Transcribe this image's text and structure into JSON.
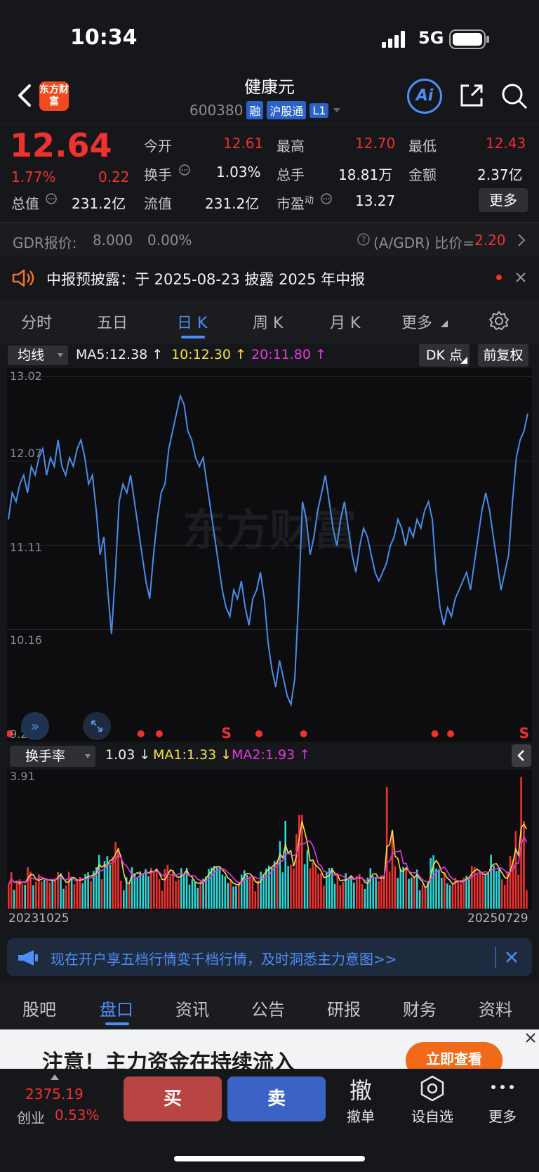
{
  "status_bar": {
    "time": "10:34",
    "network": "5G"
  },
  "header": {
    "stock_name": "健康元",
    "stock_code": "600380",
    "tags": [
      "融",
      "沪股通",
      "L1"
    ],
    "logo_text": "东方财富",
    "ai_label": "Ai"
  },
  "quote": {
    "price": "12.64",
    "change_pct": "1.77%",
    "change_amt": "0.22",
    "fields": [
      {
        "label": "今开",
        "value": "12.61",
        "color": "#f0312f"
      },
      {
        "label": "最高",
        "value": "12.70",
        "color": "#f0312f"
      },
      {
        "label": "最低",
        "value": "12.43",
        "color": "#f0312f"
      },
      {
        "label": "换手",
        "value": "1.03%",
        "color": "#f2f2f2"
      },
      {
        "label": "总手",
        "value": "18.81万",
        "color": "#f2f2f2"
      },
      {
        "label": "金额",
        "value": "2.37亿",
        "color": "#f2f2f2"
      },
      {
        "label": "总值",
        "value": "231.2亿",
        "color": "#f2f2f2"
      },
      {
        "label": "流值",
        "value": "231.2亿",
        "color": "#f2f2f2"
      },
      {
        "label": "市盈",
        "label_sup": "动",
        "value": "13.27",
        "color": "#f2f2f2"
      }
    ],
    "more_label": "更多"
  },
  "gdr": {
    "label": "GDR报价:",
    "price": "8.000",
    "pct": "0.00%",
    "ratio_label": "(A/GDR) 比价=",
    "ratio_value": "2.20"
  },
  "notice": {
    "text": "中报预披露：于 2025-08-23 披露 2025 年中报"
  },
  "chart_tabs": [
    "分时",
    "五日",
    "日 K",
    "周 K",
    "月 K",
    "更多"
  ],
  "indicator_bar": {
    "type_label": "均线",
    "ma5": "MA5:12.38",
    "ma10": "10:12.30",
    "ma20": "20:11.80",
    "dk_label": "DK 点",
    "adjust_label": "前复权"
  },
  "watermark": "东方财富",
  "chart_data": [
    {
      "type": "line",
      "name": "price",
      "ylim": [
        9.2,
        13.02
      ],
      "y_ticks": [
        "13.02",
        "12.07",
        "11.11",
        "10.16",
        "9.20"
      ],
      "x_range": [
        "20231025",
        "20250729"
      ],
      "values": [
        11.4,
        11.7,
        11.6,
        11.8,
        11.9,
        11.7,
        12.0,
        11.9,
        12.1,
        12.2,
        11.9,
        12.1,
        12.0,
        12.3,
        12.0,
        11.9,
        12.1,
        12.0,
        12.2,
        12.3,
        12.1,
        11.8,
        11.9,
        11.5,
        11.0,
        11.2,
        10.6,
        10.1,
        10.8,
        11.6,
        11.8,
        11.7,
        11.9,
        11.6,
        11.3,
        11.0,
        10.7,
        10.5,
        11.0,
        11.4,
        11.7,
        11.8,
        12.2,
        12.4,
        12.6,
        12.8,
        12.7,
        12.4,
        12.3,
        12.1,
        12.0,
        12.1,
        11.8,
        11.5,
        11.2,
        10.9,
        10.6,
        10.4,
        10.3,
        10.6,
        10.5,
        10.7,
        10.4,
        10.2,
        10.5,
        10.6,
        10.8,
        10.5,
        10.0,
        9.7,
        9.5,
        9.8,
        9.6,
        9.4,
        9.3,
        9.6,
        10.5,
        11.6,
        11.4,
        11.0,
        11.2,
        11.5,
        11.7,
        11.9,
        11.6,
        11.3,
        11.1,
        11.4,
        11.6,
        11.3,
        11.0,
        10.8,
        11.1,
        11.3,
        11.2,
        11.0,
        10.8,
        10.7,
        10.8,
        10.9,
        11.1,
        11.2,
        11.4,
        11.3,
        11.1,
        11.3,
        11.2,
        11.4,
        11.3,
        11.5,
        11.6,
        11.4,
        10.8,
        10.4,
        10.2,
        10.4,
        10.3,
        10.5,
        10.6,
        10.7,
        10.8,
        10.6,
        10.9,
        11.2,
        11.5,
        11.7,
        11.5,
        11.2,
        10.9,
        10.6,
        10.8,
        11.0,
        11.6,
        12.1,
        12.3,
        12.4,
        12.6
      ],
      "signals": [
        {
          "label": "●",
          "x_pos": 0.005
        },
        {
          "label": "●",
          "x_pos": 0.255
        },
        {
          "label": "●",
          "x_pos": 0.29
        },
        {
          "label": "S",
          "x_pos": 0.418
        },
        {
          "label": "●",
          "x_pos": 0.48
        },
        {
          "label": "●",
          "x_pos": 0.565
        },
        {
          "label": "●",
          "x_pos": 0.815
        },
        {
          "label": "●",
          "x_pos": 0.845
        },
        {
          "label": "S",
          "x_pos": 0.985
        }
      ]
    },
    {
      "type": "bar",
      "name": "turnover",
      "type_label": "换手率",
      "value": "1.03",
      "ma1": "MA1:1.33",
      "ma2": "MA2:1.93",
      "ylim": [
        0,
        3.91
      ],
      "y_top_label": "3.91"
    }
  ],
  "promo": {
    "text": "现在开户享五档行情变千档行情，及时洞悉主力意图>>"
  },
  "bottom_tabs": [
    "股吧",
    "盘口",
    "资讯",
    "公告",
    "研报",
    "财务",
    "资料"
  ],
  "ad": {
    "text": "注意！主力资金在持续流入",
    "button": "立即查看"
  },
  "bottom_bar": {
    "index_value": "2375.19",
    "index_name": "创业",
    "index_pct": "0.53%",
    "buy": "买",
    "sell": "卖",
    "cancel_icon_char": "撤",
    "cancel": "撤单",
    "watchlist": "设自选",
    "more": "更多"
  }
}
